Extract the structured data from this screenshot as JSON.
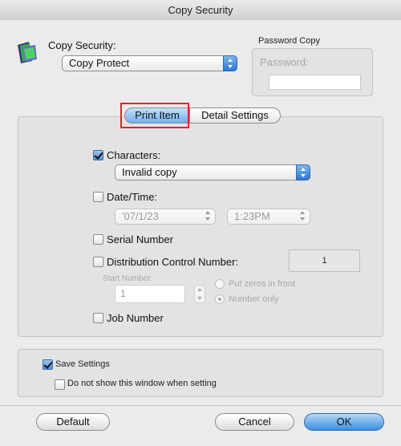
{
  "window": {
    "title": "Copy Security"
  },
  "copy_security": {
    "label": "Copy Security:",
    "selected": "Copy Protect",
    "icon": "copy-security-icon"
  },
  "password_copy": {
    "group_label": "Password Copy",
    "password_label": "Password:",
    "password_value": ""
  },
  "tabs": [
    {
      "label": "Print Item",
      "selected": true
    },
    {
      "label": "Detail Settings",
      "selected": false
    }
  ],
  "print_items": {
    "characters": {
      "label": "Characters:",
      "checked": true,
      "selected": "Invalid copy"
    },
    "datetime": {
      "label": "Date/Time:",
      "checked": false,
      "date": "'07/1/23",
      "time": "1:23PM"
    },
    "serial": {
      "label": "Serial Number",
      "checked": false
    },
    "distribution": {
      "label": "Distribution Control Number:",
      "checked": false,
      "value": "1",
      "start_label": "Start Number:",
      "start_value": "1",
      "option_zeros": "Put zeros in front",
      "option_number": "Number only"
    },
    "job": {
      "label": "Job Number",
      "checked": false
    }
  },
  "settings": {
    "save_label": "Save Settings",
    "save_checked": true,
    "dont_show_label": "Do not show this window when setting",
    "dont_show_checked": false
  },
  "buttons": {
    "default": "Default",
    "cancel": "Cancel",
    "ok": "OK"
  },
  "colors": {
    "accent": "#3c8ee0",
    "highlight_box": "#e0232a",
    "tab_selected": "#6fb0ee"
  }
}
